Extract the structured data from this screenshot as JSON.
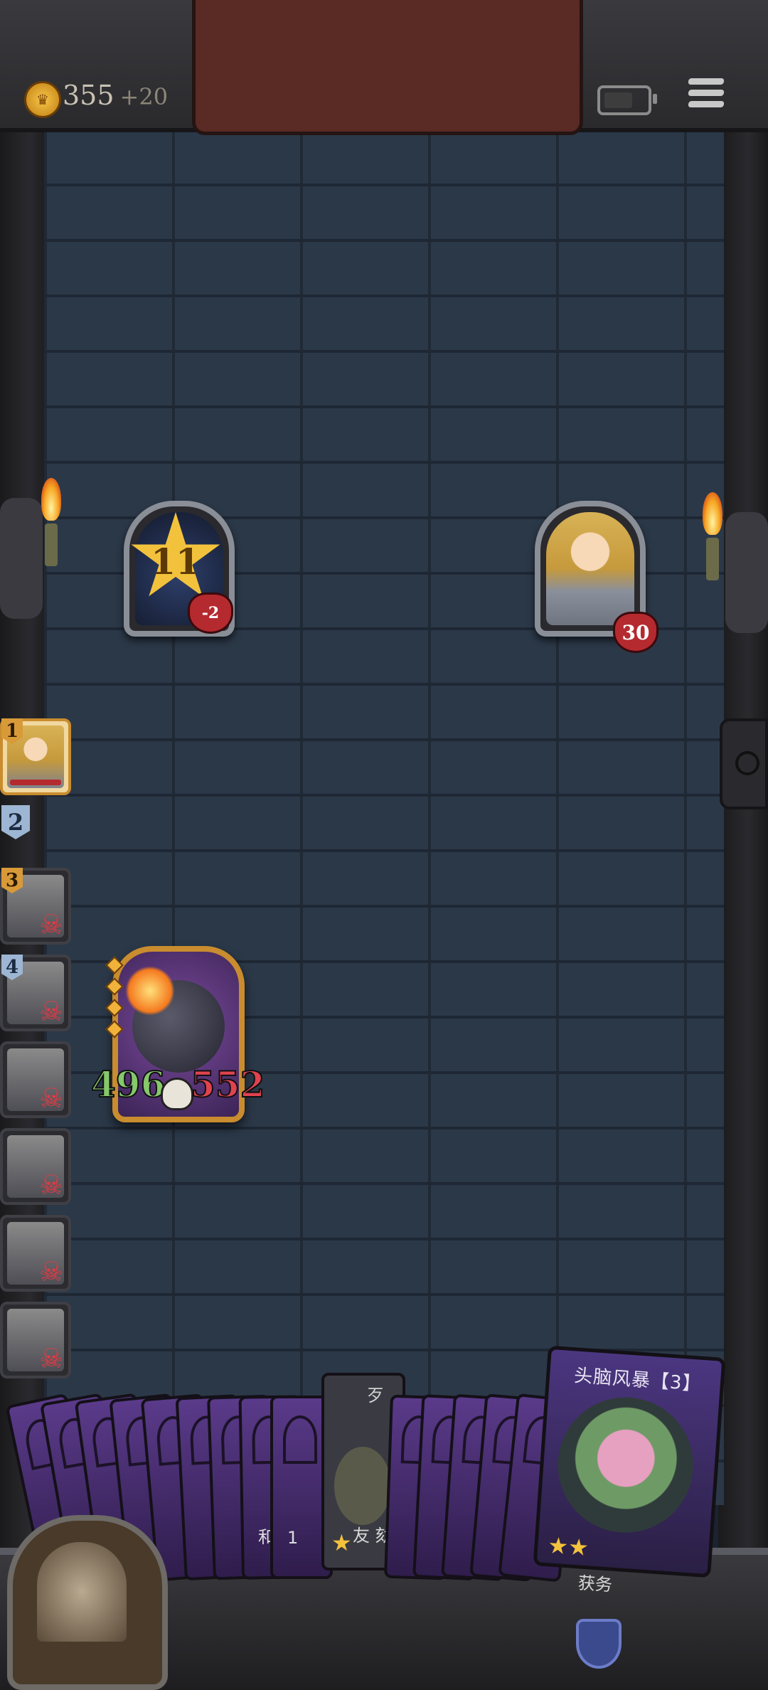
{
  "hud": {
    "coins": "355",
    "coin_bonus": "+20",
    "coin_icon": "crown-coin-icon",
    "battery_icon": "battery-icon",
    "menu_icon": "menu-icon"
  },
  "enemy": {
    "level": "11",
    "heart_value": "-2"
  },
  "hero": {
    "hp": "30"
  },
  "turn_queue": {
    "items": [
      {
        "num": "1",
        "state": "active"
      },
      {
        "num": "2",
        "state": "empty"
      },
      {
        "num": "3",
        "state": "dead"
      },
      {
        "num": "4",
        "state": "dead"
      },
      {
        "num": "",
        "state": "dead"
      },
      {
        "num": "",
        "state": "dead"
      },
      {
        "num": "",
        "state": "dead"
      },
      {
        "num": "",
        "state": "dead"
      }
    ]
  },
  "monster": {
    "attack": "496",
    "health": "552"
  },
  "hand": {
    "featured_card_title": "头脑风暴【3】",
    "featured_card_desc": "获务",
    "second_card_title": "歹",
    "second_card_desc": "友 劾",
    "small_labels": [
      "和",
      "1"
    ]
  },
  "colors": {
    "accent_gold": "#c98c2e",
    "hp_red": "#b52a2f",
    "atk_green": "#86c86a"
  }
}
